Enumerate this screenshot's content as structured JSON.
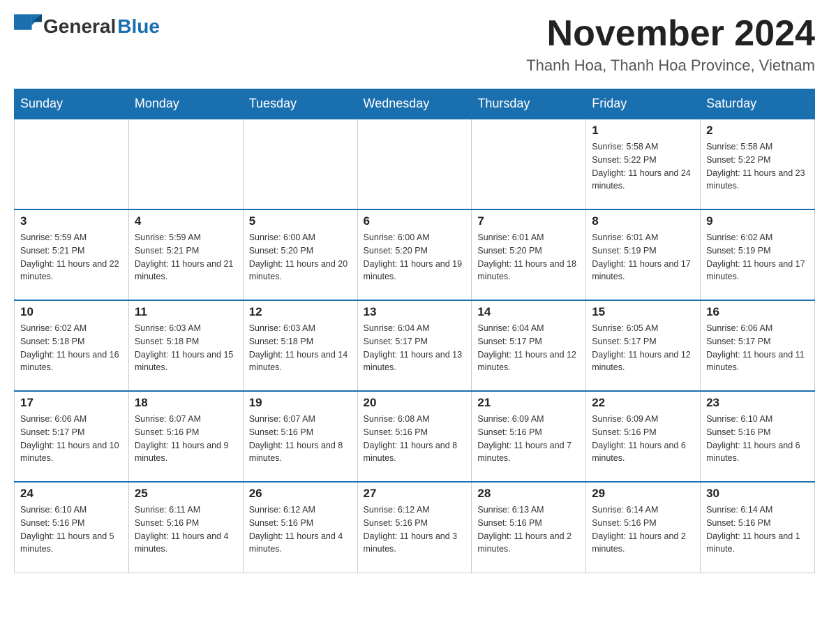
{
  "logo": {
    "text_general": "General",
    "text_blue": "Blue"
  },
  "header": {
    "month_year": "November 2024",
    "location": "Thanh Hoa, Thanh Hoa Province, Vietnam"
  },
  "weekdays": [
    "Sunday",
    "Monday",
    "Tuesday",
    "Wednesday",
    "Thursday",
    "Friday",
    "Saturday"
  ],
  "weeks": [
    [
      {
        "day": "",
        "sunrise": "",
        "sunset": "",
        "daylight": ""
      },
      {
        "day": "",
        "sunrise": "",
        "sunset": "",
        "daylight": ""
      },
      {
        "day": "",
        "sunrise": "",
        "sunset": "",
        "daylight": ""
      },
      {
        "day": "",
        "sunrise": "",
        "sunset": "",
        "daylight": ""
      },
      {
        "day": "",
        "sunrise": "",
        "sunset": "",
        "daylight": ""
      },
      {
        "day": "1",
        "sunrise": "Sunrise: 5:58 AM",
        "sunset": "Sunset: 5:22 PM",
        "daylight": "Daylight: 11 hours and 24 minutes."
      },
      {
        "day": "2",
        "sunrise": "Sunrise: 5:58 AM",
        "sunset": "Sunset: 5:22 PM",
        "daylight": "Daylight: 11 hours and 23 minutes."
      }
    ],
    [
      {
        "day": "3",
        "sunrise": "Sunrise: 5:59 AM",
        "sunset": "Sunset: 5:21 PM",
        "daylight": "Daylight: 11 hours and 22 minutes."
      },
      {
        "day": "4",
        "sunrise": "Sunrise: 5:59 AM",
        "sunset": "Sunset: 5:21 PM",
        "daylight": "Daylight: 11 hours and 21 minutes."
      },
      {
        "day": "5",
        "sunrise": "Sunrise: 6:00 AM",
        "sunset": "Sunset: 5:20 PM",
        "daylight": "Daylight: 11 hours and 20 minutes."
      },
      {
        "day": "6",
        "sunrise": "Sunrise: 6:00 AM",
        "sunset": "Sunset: 5:20 PM",
        "daylight": "Daylight: 11 hours and 19 minutes."
      },
      {
        "day": "7",
        "sunrise": "Sunrise: 6:01 AM",
        "sunset": "Sunset: 5:20 PM",
        "daylight": "Daylight: 11 hours and 18 minutes."
      },
      {
        "day": "8",
        "sunrise": "Sunrise: 6:01 AM",
        "sunset": "Sunset: 5:19 PM",
        "daylight": "Daylight: 11 hours and 17 minutes."
      },
      {
        "day": "9",
        "sunrise": "Sunrise: 6:02 AM",
        "sunset": "Sunset: 5:19 PM",
        "daylight": "Daylight: 11 hours and 17 minutes."
      }
    ],
    [
      {
        "day": "10",
        "sunrise": "Sunrise: 6:02 AM",
        "sunset": "Sunset: 5:18 PM",
        "daylight": "Daylight: 11 hours and 16 minutes."
      },
      {
        "day": "11",
        "sunrise": "Sunrise: 6:03 AM",
        "sunset": "Sunset: 5:18 PM",
        "daylight": "Daylight: 11 hours and 15 minutes."
      },
      {
        "day": "12",
        "sunrise": "Sunrise: 6:03 AM",
        "sunset": "Sunset: 5:18 PM",
        "daylight": "Daylight: 11 hours and 14 minutes."
      },
      {
        "day": "13",
        "sunrise": "Sunrise: 6:04 AM",
        "sunset": "Sunset: 5:17 PM",
        "daylight": "Daylight: 11 hours and 13 minutes."
      },
      {
        "day": "14",
        "sunrise": "Sunrise: 6:04 AM",
        "sunset": "Sunset: 5:17 PM",
        "daylight": "Daylight: 11 hours and 12 minutes."
      },
      {
        "day": "15",
        "sunrise": "Sunrise: 6:05 AM",
        "sunset": "Sunset: 5:17 PM",
        "daylight": "Daylight: 11 hours and 12 minutes."
      },
      {
        "day": "16",
        "sunrise": "Sunrise: 6:06 AM",
        "sunset": "Sunset: 5:17 PM",
        "daylight": "Daylight: 11 hours and 11 minutes."
      }
    ],
    [
      {
        "day": "17",
        "sunrise": "Sunrise: 6:06 AM",
        "sunset": "Sunset: 5:17 PM",
        "daylight": "Daylight: 11 hours and 10 minutes."
      },
      {
        "day": "18",
        "sunrise": "Sunrise: 6:07 AM",
        "sunset": "Sunset: 5:16 PM",
        "daylight": "Daylight: 11 hours and 9 minutes."
      },
      {
        "day": "19",
        "sunrise": "Sunrise: 6:07 AM",
        "sunset": "Sunset: 5:16 PM",
        "daylight": "Daylight: 11 hours and 8 minutes."
      },
      {
        "day": "20",
        "sunrise": "Sunrise: 6:08 AM",
        "sunset": "Sunset: 5:16 PM",
        "daylight": "Daylight: 11 hours and 8 minutes."
      },
      {
        "day": "21",
        "sunrise": "Sunrise: 6:09 AM",
        "sunset": "Sunset: 5:16 PM",
        "daylight": "Daylight: 11 hours and 7 minutes."
      },
      {
        "day": "22",
        "sunrise": "Sunrise: 6:09 AM",
        "sunset": "Sunset: 5:16 PM",
        "daylight": "Daylight: 11 hours and 6 minutes."
      },
      {
        "day": "23",
        "sunrise": "Sunrise: 6:10 AM",
        "sunset": "Sunset: 5:16 PM",
        "daylight": "Daylight: 11 hours and 6 minutes."
      }
    ],
    [
      {
        "day": "24",
        "sunrise": "Sunrise: 6:10 AM",
        "sunset": "Sunset: 5:16 PM",
        "daylight": "Daylight: 11 hours and 5 minutes."
      },
      {
        "day": "25",
        "sunrise": "Sunrise: 6:11 AM",
        "sunset": "Sunset: 5:16 PM",
        "daylight": "Daylight: 11 hours and 4 minutes."
      },
      {
        "day": "26",
        "sunrise": "Sunrise: 6:12 AM",
        "sunset": "Sunset: 5:16 PM",
        "daylight": "Daylight: 11 hours and 4 minutes."
      },
      {
        "day": "27",
        "sunrise": "Sunrise: 6:12 AM",
        "sunset": "Sunset: 5:16 PM",
        "daylight": "Daylight: 11 hours and 3 minutes."
      },
      {
        "day": "28",
        "sunrise": "Sunrise: 6:13 AM",
        "sunset": "Sunset: 5:16 PM",
        "daylight": "Daylight: 11 hours and 2 minutes."
      },
      {
        "day": "29",
        "sunrise": "Sunrise: 6:14 AM",
        "sunset": "Sunset: 5:16 PM",
        "daylight": "Daylight: 11 hours and 2 minutes."
      },
      {
        "day": "30",
        "sunrise": "Sunrise: 6:14 AM",
        "sunset": "Sunset: 5:16 PM",
        "daylight": "Daylight: 11 hours and 1 minute."
      }
    ]
  ]
}
